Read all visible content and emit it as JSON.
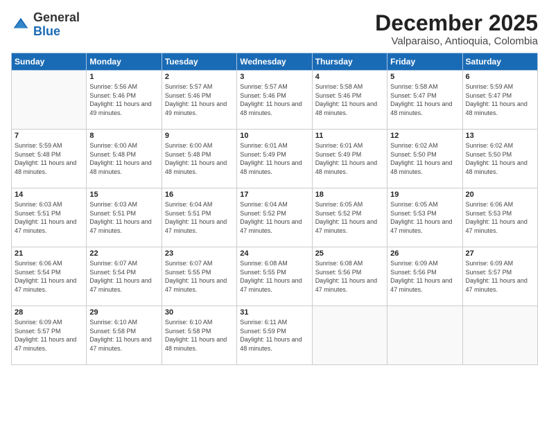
{
  "header": {
    "logo_general": "General",
    "logo_blue": "Blue",
    "month_title": "December 2025",
    "location": "Valparaiso, Antioquia, Colombia"
  },
  "days_of_week": [
    "Sunday",
    "Monday",
    "Tuesday",
    "Wednesday",
    "Thursday",
    "Friday",
    "Saturday"
  ],
  "weeks": [
    [
      {
        "day": "",
        "sunrise": "",
        "sunset": "",
        "daylight": ""
      },
      {
        "day": "1",
        "sunrise": "Sunrise: 5:56 AM",
        "sunset": "Sunset: 5:46 PM",
        "daylight": "Daylight: 11 hours and 49 minutes."
      },
      {
        "day": "2",
        "sunrise": "Sunrise: 5:57 AM",
        "sunset": "Sunset: 5:46 PM",
        "daylight": "Daylight: 11 hours and 49 minutes."
      },
      {
        "day": "3",
        "sunrise": "Sunrise: 5:57 AM",
        "sunset": "Sunset: 5:46 PM",
        "daylight": "Daylight: 11 hours and 48 minutes."
      },
      {
        "day": "4",
        "sunrise": "Sunrise: 5:58 AM",
        "sunset": "Sunset: 5:46 PM",
        "daylight": "Daylight: 11 hours and 48 minutes."
      },
      {
        "day": "5",
        "sunrise": "Sunrise: 5:58 AM",
        "sunset": "Sunset: 5:47 PM",
        "daylight": "Daylight: 11 hours and 48 minutes."
      },
      {
        "day": "6",
        "sunrise": "Sunrise: 5:59 AM",
        "sunset": "Sunset: 5:47 PM",
        "daylight": "Daylight: 11 hours and 48 minutes."
      }
    ],
    [
      {
        "day": "7",
        "sunrise": "Sunrise: 5:59 AM",
        "sunset": "Sunset: 5:48 PM",
        "daylight": "Daylight: 11 hours and 48 minutes."
      },
      {
        "day": "8",
        "sunrise": "Sunrise: 6:00 AM",
        "sunset": "Sunset: 5:48 PM",
        "daylight": "Daylight: 11 hours and 48 minutes."
      },
      {
        "day": "9",
        "sunrise": "Sunrise: 6:00 AM",
        "sunset": "Sunset: 5:48 PM",
        "daylight": "Daylight: 11 hours and 48 minutes."
      },
      {
        "day": "10",
        "sunrise": "Sunrise: 6:01 AM",
        "sunset": "Sunset: 5:49 PM",
        "daylight": "Daylight: 11 hours and 48 minutes."
      },
      {
        "day": "11",
        "sunrise": "Sunrise: 6:01 AM",
        "sunset": "Sunset: 5:49 PM",
        "daylight": "Daylight: 11 hours and 48 minutes."
      },
      {
        "day": "12",
        "sunrise": "Sunrise: 6:02 AM",
        "sunset": "Sunset: 5:50 PM",
        "daylight": "Daylight: 11 hours and 48 minutes."
      },
      {
        "day": "13",
        "sunrise": "Sunrise: 6:02 AM",
        "sunset": "Sunset: 5:50 PM",
        "daylight": "Daylight: 11 hours and 48 minutes."
      }
    ],
    [
      {
        "day": "14",
        "sunrise": "Sunrise: 6:03 AM",
        "sunset": "Sunset: 5:51 PM",
        "daylight": "Daylight: 11 hours and 47 minutes."
      },
      {
        "day": "15",
        "sunrise": "Sunrise: 6:03 AM",
        "sunset": "Sunset: 5:51 PM",
        "daylight": "Daylight: 11 hours and 47 minutes."
      },
      {
        "day": "16",
        "sunrise": "Sunrise: 6:04 AM",
        "sunset": "Sunset: 5:51 PM",
        "daylight": "Daylight: 11 hours and 47 minutes."
      },
      {
        "day": "17",
        "sunrise": "Sunrise: 6:04 AM",
        "sunset": "Sunset: 5:52 PM",
        "daylight": "Daylight: 11 hours and 47 minutes."
      },
      {
        "day": "18",
        "sunrise": "Sunrise: 6:05 AM",
        "sunset": "Sunset: 5:52 PM",
        "daylight": "Daylight: 11 hours and 47 minutes."
      },
      {
        "day": "19",
        "sunrise": "Sunrise: 6:05 AM",
        "sunset": "Sunset: 5:53 PM",
        "daylight": "Daylight: 11 hours and 47 minutes."
      },
      {
        "day": "20",
        "sunrise": "Sunrise: 6:06 AM",
        "sunset": "Sunset: 5:53 PM",
        "daylight": "Daylight: 11 hours and 47 minutes."
      }
    ],
    [
      {
        "day": "21",
        "sunrise": "Sunrise: 6:06 AM",
        "sunset": "Sunset: 5:54 PM",
        "daylight": "Daylight: 11 hours and 47 minutes."
      },
      {
        "day": "22",
        "sunrise": "Sunrise: 6:07 AM",
        "sunset": "Sunset: 5:54 PM",
        "daylight": "Daylight: 11 hours and 47 minutes."
      },
      {
        "day": "23",
        "sunrise": "Sunrise: 6:07 AM",
        "sunset": "Sunset: 5:55 PM",
        "daylight": "Daylight: 11 hours and 47 minutes."
      },
      {
        "day": "24",
        "sunrise": "Sunrise: 6:08 AM",
        "sunset": "Sunset: 5:55 PM",
        "daylight": "Daylight: 11 hours and 47 minutes."
      },
      {
        "day": "25",
        "sunrise": "Sunrise: 6:08 AM",
        "sunset": "Sunset: 5:56 PM",
        "daylight": "Daylight: 11 hours and 47 minutes."
      },
      {
        "day": "26",
        "sunrise": "Sunrise: 6:09 AM",
        "sunset": "Sunset: 5:56 PM",
        "daylight": "Daylight: 11 hours and 47 minutes."
      },
      {
        "day": "27",
        "sunrise": "Sunrise: 6:09 AM",
        "sunset": "Sunset: 5:57 PM",
        "daylight": "Daylight: 11 hours and 47 minutes."
      }
    ],
    [
      {
        "day": "28",
        "sunrise": "Sunrise: 6:09 AM",
        "sunset": "Sunset: 5:57 PM",
        "daylight": "Daylight: 11 hours and 47 minutes."
      },
      {
        "day": "29",
        "sunrise": "Sunrise: 6:10 AM",
        "sunset": "Sunset: 5:58 PM",
        "daylight": "Daylight: 11 hours and 47 minutes."
      },
      {
        "day": "30",
        "sunrise": "Sunrise: 6:10 AM",
        "sunset": "Sunset: 5:58 PM",
        "daylight": "Daylight: 11 hours and 48 minutes."
      },
      {
        "day": "31",
        "sunrise": "Sunrise: 6:11 AM",
        "sunset": "Sunset: 5:59 PM",
        "daylight": "Daylight: 11 hours and 48 minutes."
      },
      {
        "day": "",
        "sunrise": "",
        "sunset": "",
        "daylight": ""
      },
      {
        "day": "",
        "sunrise": "",
        "sunset": "",
        "daylight": ""
      },
      {
        "day": "",
        "sunrise": "",
        "sunset": "",
        "daylight": ""
      }
    ]
  ]
}
